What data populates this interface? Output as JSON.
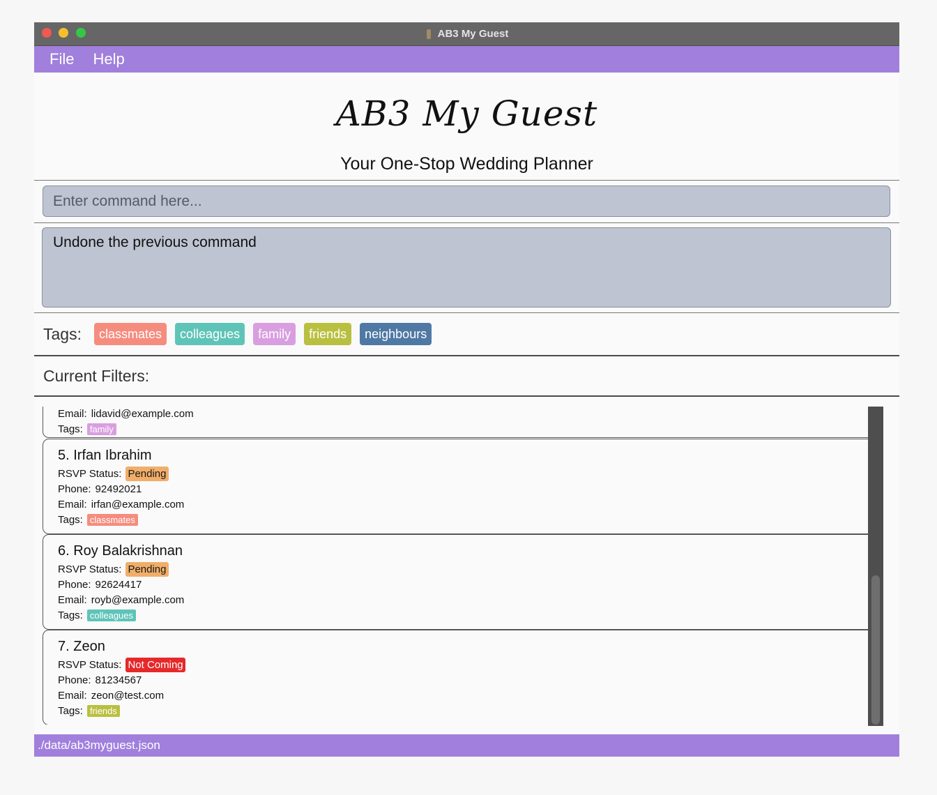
{
  "window": {
    "title": "AB3 My Guest"
  },
  "menu": {
    "items": [
      "File",
      "Help"
    ]
  },
  "header": {
    "title": "AB3 My Guest",
    "subtitle": "Your One-Stop Wedding Planner"
  },
  "command": {
    "placeholder": "Enter command here...",
    "value": ""
  },
  "result": {
    "text": "Undone the previous command"
  },
  "tags_bar": {
    "label": "Tags:",
    "tags": [
      {
        "label": "classmates",
        "color": "#f58c7e"
      },
      {
        "label": "colleagues",
        "color": "#5fc4b8"
      },
      {
        "label": "family",
        "color": "#d99ee0"
      },
      {
        "label": "friends",
        "color": "#b9c040"
      },
      {
        "label": "neighbours",
        "color": "#4f79a4"
      }
    ]
  },
  "filters_bar": {
    "label": "Current Filters:"
  },
  "guest_list": {
    "partial_card": {
      "email_label": "Email:",
      "email": "lidavid@example.com",
      "tags_label": "Tags:",
      "tags": [
        {
          "label": "family",
          "color": "#d99ee0"
        }
      ]
    },
    "cards": [
      {
        "name": "5. Irfan Ibrahim",
        "rsvp_label": "RSVP Status:",
        "rsvp": "Pending",
        "rsvp_color": "#f0ae6a",
        "rsvp_text_color": "#1a1a1a",
        "phone_label": "Phone:",
        "phone": "92492021",
        "email_label": "Email:",
        "email": "irfan@example.com",
        "tags_label": "Tags:",
        "tags": [
          {
            "label": "classmates",
            "color": "#f58c7e"
          }
        ]
      },
      {
        "name": "6. Roy Balakrishnan",
        "rsvp_label": "RSVP Status:",
        "rsvp": "Pending",
        "rsvp_color": "#f0ae6a",
        "rsvp_text_color": "#1a1a1a",
        "phone_label": "Phone:",
        "phone": "92624417",
        "email_label": "Email:",
        "email": "royb@example.com",
        "tags_label": "Tags:",
        "tags": [
          {
            "label": "colleagues",
            "color": "#5fc4b8"
          }
        ]
      },
      {
        "name": "7. Zeon",
        "rsvp_label": "RSVP Status:",
        "rsvp": "Not Coming",
        "rsvp_color": "#e5292b",
        "rsvp_text_color": "#ffffff",
        "phone_label": "Phone:",
        "phone": "81234567",
        "email_label": "Email:",
        "email": "zeon@test.com",
        "tags_label": "Tags:",
        "tags": [
          {
            "label": "friends",
            "color": "#b9c040"
          }
        ]
      }
    ]
  },
  "statusbar": {
    "path": "./data/ab3myguest.json"
  }
}
